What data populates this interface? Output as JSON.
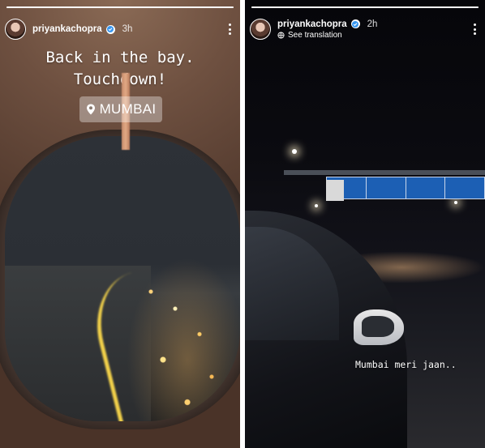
{
  "stories": [
    {
      "username": "priyankachopra",
      "time": "3h",
      "caption_line1": "Back in the bay.",
      "caption_line2": "Touchdown!",
      "location": "MUMBAI",
      "progress": 1.0
    },
    {
      "username": "priyankachopra",
      "time": "2h",
      "translation_link": "See translation",
      "caption": "Mumbai meri jaan..",
      "progress": 1.0
    }
  ],
  "colors": {
    "verified_check": "#3897f0",
    "text": "#ffffff"
  },
  "icons": {
    "verified": "verified-badge-icon",
    "more": "more-options-icon",
    "location": "location-pin-icon",
    "translate": "translate-icon"
  }
}
